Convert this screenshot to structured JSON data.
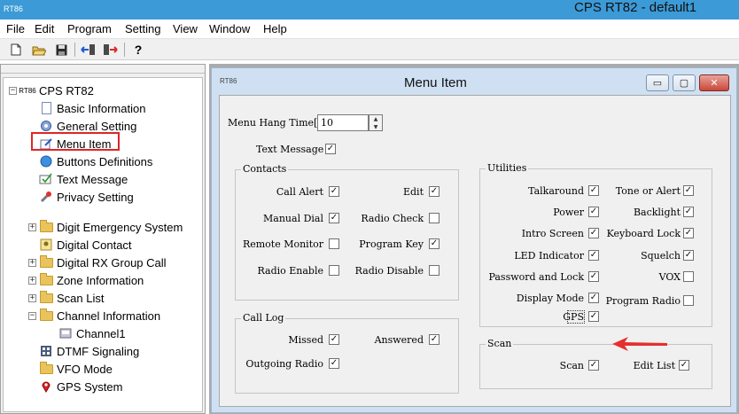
{
  "app": {
    "logo_text": "RT86",
    "title": "CPS RT82 - default1",
    "colors": {
      "titlebar": "#3c9ad6",
      "highlight": "#e02525",
      "arrow": "#e53030"
    }
  },
  "menu": [
    "File",
    "Edit",
    "Program",
    "Setting",
    "View",
    "Window",
    "Help"
  ],
  "toolbar": {
    "buttons": [
      "new-file-icon",
      "open-folder-icon",
      "save-icon",
      "read-radio-icon",
      "write-radio-icon",
      "help-icon"
    ]
  },
  "tree": {
    "root": "CPS RT82",
    "items": [
      {
        "label": "Basic Information",
        "icon": "document-icon"
      },
      {
        "label": "General Setting",
        "icon": "gear-icon"
      },
      {
        "label": "Menu Item",
        "icon": "edit-icon"
      },
      {
        "label": "Buttons Definitions",
        "icon": "button-icon"
      },
      {
        "label": "Text Message",
        "icon": "message-icon"
      },
      {
        "label": "Privacy Setting",
        "icon": "tools-icon"
      },
      {
        "label": "Digit Emergency System",
        "icon": "folder-icon"
      },
      {
        "label": "Digital Contact",
        "icon": "contact-icon"
      },
      {
        "label": "Digital RX Group Call",
        "icon": "folder-icon"
      },
      {
        "label": "Zone Information",
        "icon": "folder-icon"
      },
      {
        "label": "Scan List",
        "icon": "folder-icon"
      },
      {
        "label": "Channel Information",
        "icon": "folder-icon"
      },
      {
        "label": "Channel1",
        "icon": "channel-icon"
      },
      {
        "label": "DTMF Signaling",
        "icon": "keypad-icon"
      },
      {
        "label": "VFO Mode",
        "icon": "folder-icon"
      },
      {
        "label": "GPS System",
        "icon": "gps-pin-icon"
      }
    ]
  },
  "window": {
    "logo_text": "RT86",
    "title": "Menu Item",
    "buttons": {
      "minimize": "▭",
      "restore": "▢",
      "close": "✕"
    }
  },
  "menu_item": {
    "hang_time_label": "Menu Hang Time[s]",
    "hang_time_value": "10",
    "text_message_label": "Text Message",
    "text_message_checked": true,
    "contacts": {
      "title": "Contacts",
      "items": [
        {
          "label": "Call Alert",
          "checked": true
        },
        {
          "label": "Edit",
          "checked": true
        },
        {
          "label": "Manual Dial",
          "checked": true
        },
        {
          "label": "Radio Check",
          "checked": false
        },
        {
          "label": "Remote Monitor",
          "checked": false
        },
        {
          "label": "Program Key",
          "checked": true
        },
        {
          "label": "Radio Enable",
          "checked": false
        },
        {
          "label": "Radio Disable",
          "checked": false
        }
      ]
    },
    "call_log": {
      "title": "Call Log",
      "items": [
        {
          "label": "Missed",
          "checked": true
        },
        {
          "label": "Answered",
          "checked": true
        },
        {
          "label": "Outgoing Radio",
          "checked": true
        }
      ]
    },
    "utilities": {
      "title": "Utilities",
      "items": [
        {
          "label": "Talkaround",
          "checked": true
        },
        {
          "label": "Tone or Alert",
          "checked": true
        },
        {
          "label": "Power",
          "checked": true
        },
        {
          "label": "Backlight",
          "checked": true
        },
        {
          "label": "Intro Screen",
          "checked": true
        },
        {
          "label": "Keyboard Lock",
          "checked": true
        },
        {
          "label": "LED Indicator",
          "checked": true
        },
        {
          "label": "Squelch",
          "checked": true
        },
        {
          "label": "Password and Lock",
          "checked": true
        },
        {
          "label": "VOX",
          "checked": false
        },
        {
          "label": "Display Mode",
          "checked": true
        },
        {
          "label": "Program Radio",
          "checked": false
        },
        {
          "label": "GPS",
          "checked": true
        }
      ]
    },
    "scan": {
      "title": "Scan",
      "items": [
        {
          "label": "Scan",
          "checked": true
        },
        {
          "label": "Edit List",
          "checked": true
        }
      ]
    }
  }
}
